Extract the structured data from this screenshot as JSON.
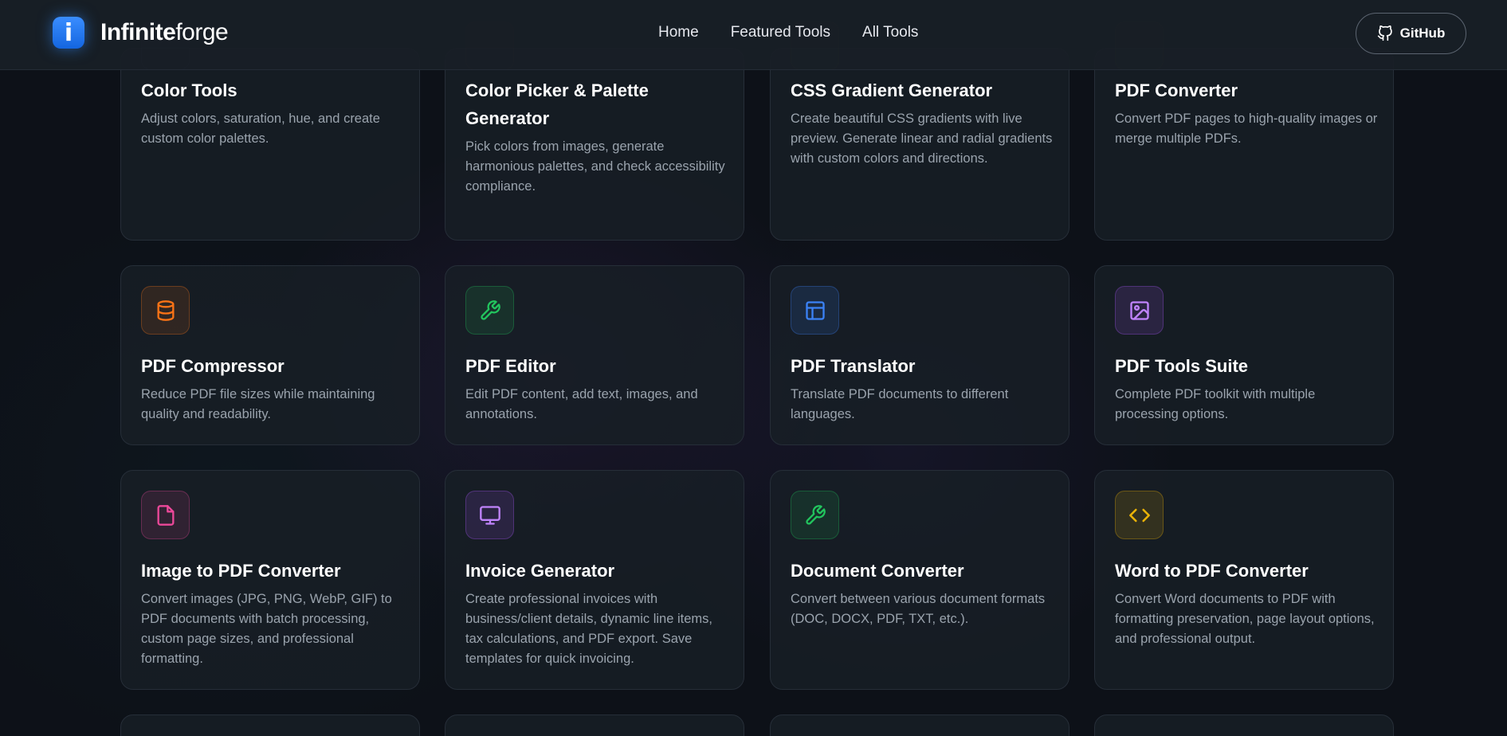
{
  "header": {
    "logo_mark": "i",
    "brand_bold": "Infinite",
    "brand_regular": "forge",
    "nav": [
      "Home",
      "Featured Tools",
      "All Tools"
    ],
    "github_label": "GitHub"
  },
  "tools": [
    {
      "title": "Color Tools",
      "desc": "Adjust colors, saturation, hue, and create custom color palettes.",
      "icon": "palette-icon",
      "color": "#a855f7"
    },
    {
      "title": "Color Picker & Palette Generator",
      "desc": "Pick colors from images, generate harmonious palettes, and check accessibility compliance.",
      "icon": "pipette-icon",
      "color": "#ef4444"
    },
    {
      "title": "CSS Gradient Generator",
      "desc": "Create beautiful CSS gradients with live preview. Generate linear and radial gradients with custom colors and directions.",
      "icon": "gradient-icon",
      "color": "#eab308"
    },
    {
      "title": "PDF Converter",
      "desc": "Convert PDF pages to high-quality images or merge multiple PDFs.",
      "icon": "file-icon",
      "color": "#eab308"
    },
    {
      "title": "PDF Compressor",
      "desc": "Reduce PDF file sizes while maintaining quality and readability.",
      "icon": "database-icon",
      "color": "#f97316"
    },
    {
      "title": "PDF Editor",
      "desc": "Edit PDF content, add text, images, and annotations.",
      "icon": "wrench-icon",
      "color": "#22c55e"
    },
    {
      "title": "PDF Translator",
      "desc": "Translate PDF documents to different languages.",
      "icon": "layout-icon",
      "color": "#3b82f6"
    },
    {
      "title": "PDF Tools Suite",
      "desc": "Complete PDF toolkit with multiple processing options.",
      "icon": "image-icon",
      "color": "#a855f7"
    },
    {
      "title": "Image to PDF Converter",
      "desc": "Convert images (JPG, PNG, WebP, GIF) to PDF documents with batch processing, custom page sizes, and professional formatting.",
      "icon": "file-icon",
      "color": "#ec4899"
    },
    {
      "title": "Invoice Generator",
      "desc": "Create professional invoices with business/client details, dynamic line items, tax calculations, and PDF export. Save templates for quick invoicing.",
      "icon": "monitor-icon",
      "color": "#a855f7"
    },
    {
      "title": "Document Converter",
      "desc": "Convert between various document formats (DOC, DOCX, PDF, TXT, etc.).",
      "icon": "wrench-icon",
      "color": "#22c55e"
    },
    {
      "title": "Word to PDF Converter",
      "desc": "Convert Word documents to PDF with formatting preservation, page layout options, and professional output.",
      "icon": "code-icon",
      "color": "#eab308"
    }
  ]
}
